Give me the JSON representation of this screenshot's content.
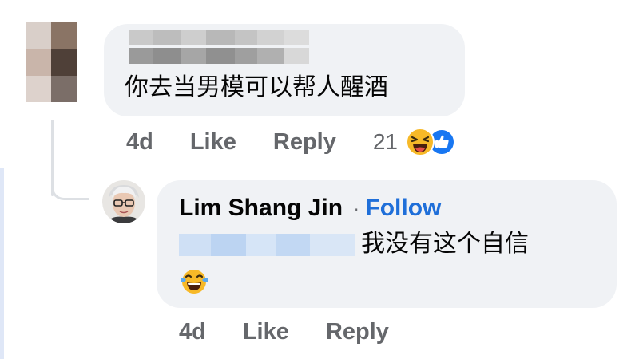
{
  "parent_comment": {
    "text": "你去当男模可以帮人醒酒",
    "time": "4d",
    "like_label": "Like",
    "reply_label": "Reply",
    "reaction_count": "21",
    "reaction_icons": [
      "laughing-emoji-icon",
      "like-thumb-icon"
    ]
  },
  "reply": {
    "author": "Lim Shang Jin",
    "separator": "·",
    "follow_label": "Follow",
    "text": "我没有这个自信",
    "emoji_icon": "tears-of-joy-emoji-icon",
    "time": "4d",
    "like_label": "Like",
    "reply_label": "Reply"
  },
  "colors": {
    "bubble_bg": "#f0f2f5",
    "link_blue": "#1f6fd9",
    "meta_grey": "#65676b",
    "text": "#050505"
  }
}
